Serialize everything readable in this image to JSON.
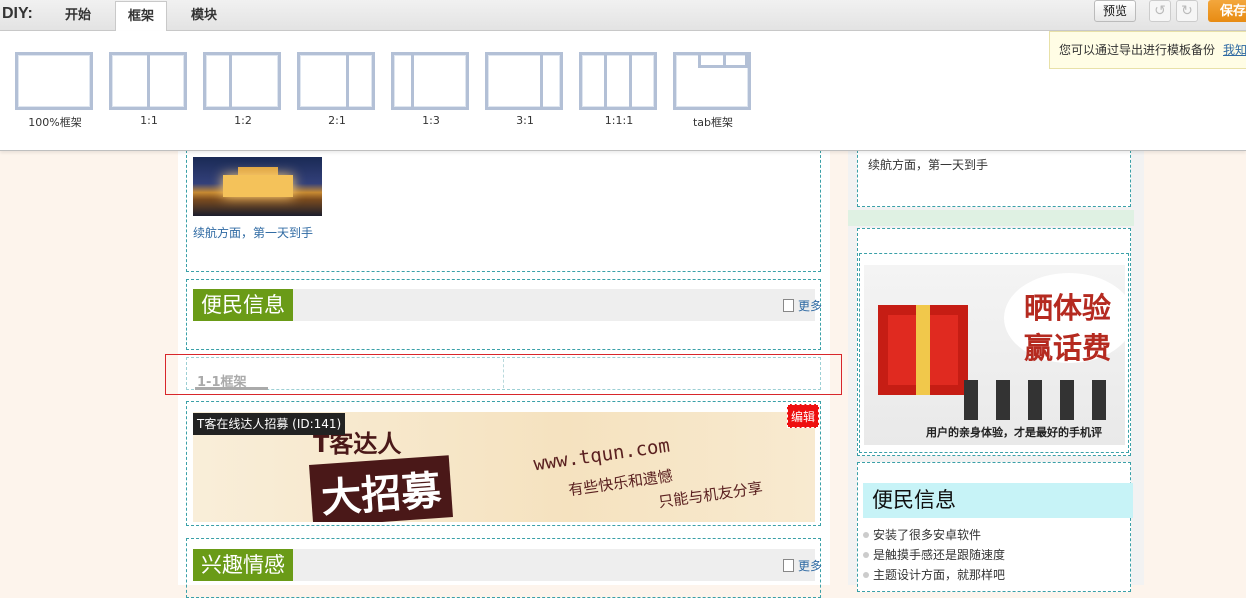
{
  "diy": {
    "label": "DIY:",
    "tabs": [
      {
        "label": "开始",
        "active": false
      },
      {
        "label": "框架",
        "active": true
      },
      {
        "label": "模块",
        "active": false
      }
    ],
    "preview_label": "预览",
    "undo_icon": "undo-icon",
    "redo_icon": "redo-icon",
    "save_label": "保存",
    "tip_text": "您可以通过导出进行模板备份",
    "tip_link": "我知"
  },
  "frames": [
    {
      "label": "100%框架",
      "cols": [
        1
      ]
    },
    {
      "label": "1:1",
      "cols": [
        1,
        1
      ]
    },
    {
      "label": "1:2",
      "cols": [
        1,
        2
      ]
    },
    {
      "label": "2:1",
      "cols": [
        2,
        1
      ]
    },
    {
      "label": "1:3",
      "cols": [
        1,
        3
      ]
    },
    {
      "label": "3:1",
      "cols": [
        3,
        1
      ]
    },
    {
      "label": "1:1:1",
      "cols": [
        1,
        1,
        1
      ]
    },
    {
      "label": "tab框架",
      "cols": [
        1
      ]
    }
  ],
  "page": {
    "right_top_caption": "续航方面，第一天到手",
    "photo_caption": "续航方面，第一天到手",
    "section1_title": "便民信息",
    "more_label": "更多",
    "frame_label": "1-1框架",
    "module_tooltip": "T客在线达人招募 (ID:141)",
    "edit_label": "编辑",
    "banner_small": "T客达人",
    "banner_big": "大招募",
    "banner_url": "www.tqun.com",
    "banner_line1": "有些快乐和遗憾",
    "banner_line2": "只能与机友分享",
    "section2_title": "兴趣情感",
    "ad_line1": "晒体验",
    "ad_line2": "赢话费",
    "ad_slogan": "用户的亲身体验，才是最好的手机评",
    "right_section_title": "便民信息",
    "right_list": [
      "安装了很多安卓软件",
      "是触摸手感还是跟随速度",
      "主题设计方面，就那样吧"
    ]
  }
}
